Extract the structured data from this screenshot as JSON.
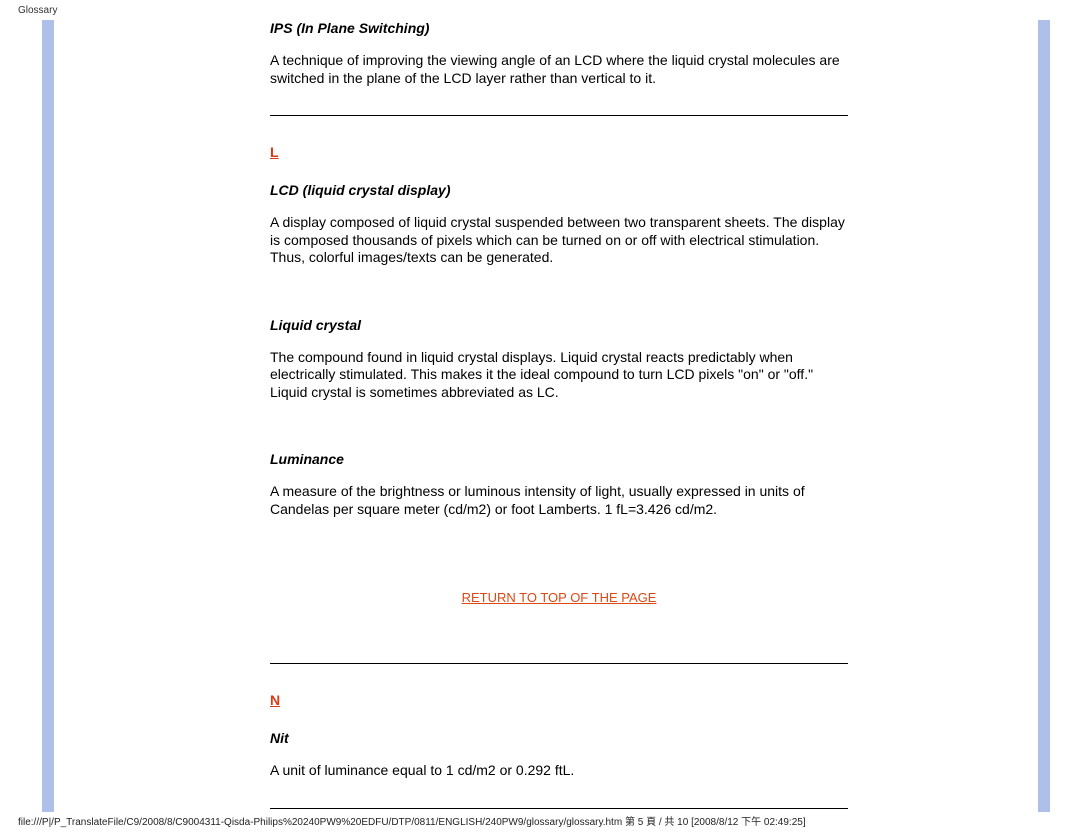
{
  "header": {
    "label": "Glossary"
  },
  "terms": {
    "ips": {
      "title": "IPS (In Plane Switching)",
      "body": "A technique of improving the viewing angle of an LCD where the liquid crystal molecules are switched in the plane of the LCD layer rather than vertical to it."
    },
    "lcd": {
      "title": "LCD (liquid crystal display)",
      "body": "A display composed of liquid crystal suspended between two transparent sheets. The display is composed thousands of pixels which can be turned on or off with electrical stimulation. Thus, colorful images/texts can be generated."
    },
    "liquid_crystal": {
      "title": "Liquid crystal",
      "body": "The compound found in liquid crystal displays. Liquid crystal reacts predictably when electrically stimulated. This makes it the ideal compound to turn LCD pixels \"on\" or \"off.\" Liquid crystal is sometimes abbreviated as LC."
    },
    "luminance": {
      "title": "Luminance",
      "body": "A measure of the brightness or luminous intensity of light, usually expressed in units of Candelas per square meter (cd/m2) or foot Lamberts. 1 fL=3.426 cd/m2."
    },
    "nit": {
      "title": "Nit",
      "body": "A unit of luminance equal to 1 cd/m2 or 0.292 ftL."
    }
  },
  "letters": {
    "L": "L",
    "N": "N"
  },
  "links": {
    "return_top": "RETURN TO TOP OF THE PAGE"
  },
  "footer": "file:///P|/P_TranslateFile/C9/2008/8/C9004311-Qisda-Philips%20240PW9%20EDFU/DTP/0811/ENGLISH/240PW9/glossary/glossary.htm 第 5 頁 / 共 10 [2008/8/12 下午 02:49:25]"
}
